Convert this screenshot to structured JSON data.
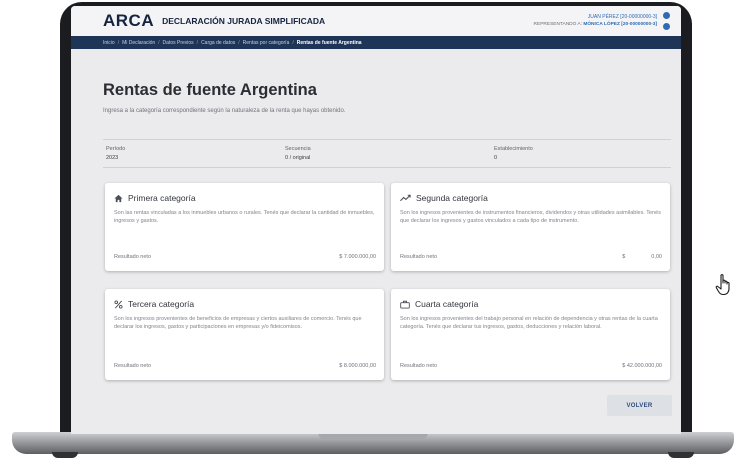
{
  "header": {
    "logo": "ARCA",
    "title": "DECLARACIÓN JURADA SIMPLIFICADA",
    "user_line1": "JUAN PÉREZ [20-00000000-3]",
    "user_line2_prefix": "REPRESENTANDO A:",
    "user_line2_name": "MÓNICA LÓPEZ [20-00000000-3]"
  },
  "breadcrumb": [
    "Inicio",
    "Mi Declaración",
    "Datos Previos",
    "Carga de datos",
    "Rentas por categoría",
    "Rentas de fuente Argentina"
  ],
  "page": {
    "title": "Rentas de fuente Argentina",
    "subtitle": "Ingresa a la categoría correspondiente según la naturaleza de la renta que hayas obtenido."
  },
  "meta": {
    "periodo_label": "Período",
    "periodo_value": "2023",
    "secuencia_label": "Secuencia",
    "secuencia_value": "0 / original",
    "establecimiento_label": "Establecimiento",
    "establecimiento_value": "0"
  },
  "cards": [
    {
      "title": "Primera categoría",
      "icon": "house-icon",
      "description": "Son las rentas vinculadas a los inmuebles urbanos o rurales. Tenés que declarar la cantidad de inmuebles, ingresos y gastos.",
      "result_label": "Resultado neto",
      "result_value": "$ 7.000.000,00"
    },
    {
      "title": "Segunda categoría",
      "icon": "trend-up-icon",
      "description": "Son los ingresos provenientes de instrumentos financieros, dividendos y otras utilidades asimilables. Tenés que declarar los ingresos y gastos vinculados a cada tipo de instrumento.",
      "result_label": "Resultado neto",
      "result_currency": "$",
      "result_value": "0,00"
    },
    {
      "title": "Tercera categoría",
      "icon": "percent-icon",
      "description": "Son los ingresos provenientes de beneficios de empresas y ciertos auxiliares de comercio. Tenés que declarar los ingresos, gastos y participaciones en empresas y/o fideicomisos.",
      "result_label": "Resultado neto",
      "result_value": "$ 8.000.000,00"
    },
    {
      "title": "Cuarta categoría",
      "icon": "briefcase-icon",
      "description": "Son los ingresos provenientes del trabajo personal en relación de dependencia y otras rentas de la cuarta categoría. Tenés que declarar tus ingresos, gastos, deducciones y relación laboral.",
      "result_label": "Resultado neto",
      "result_value": "$ 42.000.000,00"
    }
  ],
  "actions": {
    "volver": "VOLVER"
  },
  "colors": {
    "navy": "#1e3558",
    "brand": "#16243f",
    "accent": "#2e6bb3",
    "background": "#ebebed"
  }
}
